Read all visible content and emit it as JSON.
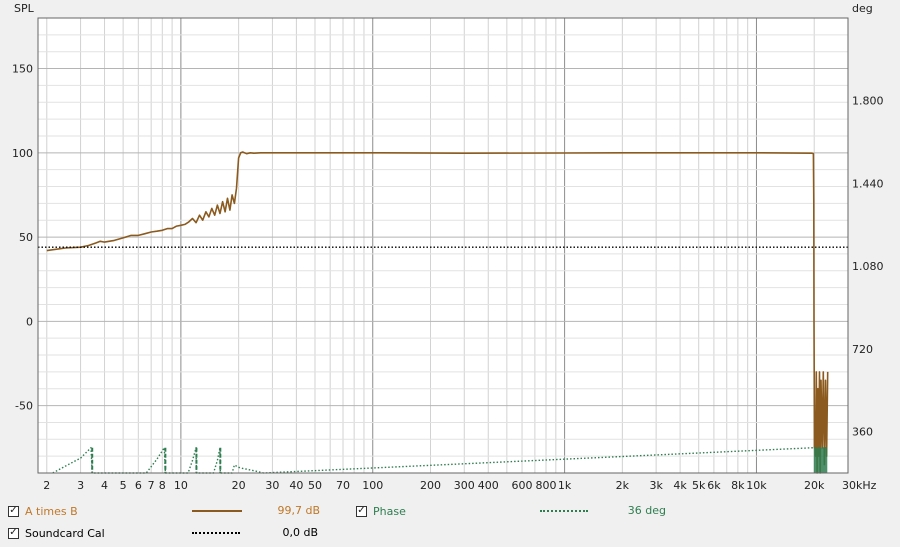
{
  "chart_data": {
    "type": "line",
    "xlabel": "",
    "xunit": "kHz",
    "xscale": "log",
    "xlim": [
      1.8,
      30000
    ],
    "x_ticks": [
      {
        "v": 2,
        "l": "2"
      },
      {
        "v": 3,
        "l": "3"
      },
      {
        "v": 4,
        "l": "4"
      },
      {
        "v": 5,
        "l": "5"
      },
      {
        "v": 6,
        "l": "6"
      },
      {
        "v": 7,
        "l": "7"
      },
      {
        "v": 8,
        "l": "8"
      },
      {
        "v": 10,
        "l": "10"
      },
      {
        "v": 20,
        "l": "20"
      },
      {
        "v": 30,
        "l": "30"
      },
      {
        "v": 40,
        "l": "40"
      },
      {
        "v": 50,
        "l": "50"
      },
      {
        "v": 70,
        "l": "70"
      },
      {
        "v": 100,
        "l": "100"
      },
      {
        "v": 200,
        "l": "200"
      },
      {
        "v": 300,
        "l": "300"
      },
      {
        "v": 400,
        "l": "400"
      },
      {
        "v": 600,
        "l": "600"
      },
      {
        "v": 800,
        "l": "800"
      },
      {
        "v": 1000,
        "l": "1k"
      },
      {
        "v": 2000,
        "l": "2k"
      },
      {
        "v": 3000,
        "l": "3k"
      },
      {
        "v": 4000,
        "l": "4k"
      },
      {
        "v": 5000,
        "l": "5k"
      },
      {
        "v": 6000,
        "l": "6k"
      },
      {
        "v": 8000,
        "l": "8k"
      },
      {
        "v": 10000,
        "l": "10k"
      },
      {
        "v": 20000,
        "l": "20k"
      },
      {
        "v": 30000,
        "l": "30kHz"
      }
    ],
    "ylabel_left": "SPL",
    "ylim_left": [
      -90,
      180
    ],
    "y_ticks_left": [
      -50,
      0,
      50,
      100,
      150
    ],
    "ylabel_right": "deg",
    "ylim_right": [
      180,
      2160
    ],
    "y_ticks_right": [
      {
        "v": 360,
        "l": "360"
      },
      {
        "v": 720,
        "l": "720"
      },
      {
        "v": 1080,
        "l": "1.080"
      },
      {
        "v": 1440,
        "l": "1.440"
      },
      {
        "v": 1800,
        "l": "1.800"
      }
    ],
    "grid": true,
    "series": [
      {
        "name": "A times B",
        "axis": "left",
        "color": "#8b5a1e",
        "style": "solid",
        "x": [
          2,
          2.5,
          3,
          3.3,
          3.6,
          3.8,
          4,
          4.5,
          5,
          5.5,
          6,
          6.5,
          7,
          7.5,
          8,
          8.5,
          9,
          9.5,
          10,
          10.5,
          11,
          11.5,
          12,
          12.5,
          13,
          13.5,
          14,
          14.5,
          15,
          15.5,
          16,
          16.5,
          17,
          17.5,
          18,
          18.5,
          19,
          19.5,
          20,
          20.5,
          21,
          22,
          23,
          24,
          26,
          30,
          40,
          100,
          300,
          1000,
          2000,
          5000,
          10000,
          19500,
          19800,
          19900,
          19950,
          20000,
          20050,
          20150,
          20300,
          20500,
          20700,
          20900,
          21100,
          21300,
          21500,
          21700,
          22000,
          22300,
          22600,
          22900,
          23200,
          23500
        ],
        "values": [
          42,
          43.5,
          44,
          45,
          46.5,
          47.5,
          47,
          48,
          49.5,
          51,
          51,
          52,
          53,
          53.5,
          54,
          55,
          55,
          56.5,
          57,
          57.5,
          59,
          61,
          58.5,
          63,
          60,
          65,
          62,
          67,
          63,
          69,
          64,
          71,
          65,
          73,
          66,
          75,
          70,
          79,
          97,
          100,
          100.5,
          99.5,
          100,
          99.8,
          100,
          100,
          100,
          100,
          99.8,
          99.9,
          100,
          100,
          100,
          99.8,
          99.5,
          70,
          0,
          -30,
          -75,
          -55,
          -80,
          -30,
          -90,
          -40,
          -80,
          -30,
          -90,
          -35,
          -75,
          -30,
          -85,
          -35,
          -80,
          -30
        ],
        "value_label": "99,7 dB"
      },
      {
        "name": "Phase",
        "axis": "right",
        "color": "#2e7d50",
        "style": "dotted",
        "x": [
          2.15,
          2.5,
          3,
          3.4,
          3.45,
          6.6,
          7.5,
          8.2,
          8.3,
          10.9,
          11.5,
          12,
          12.05,
          14.8,
          15.5,
          16,
          16.05,
          18.5,
          19,
          20,
          21,
          24,
          27,
          19900,
          20000,
          22000,
          23400
        ],
        "values": [
          180,
          210,
          245,
          290,
          180,
          180,
          240,
          290,
          180,
          180,
          235,
          290,
          180,
          180,
          235,
          290,
          180,
          180,
          215,
          205,
          200,
          190,
          180,
          290,
          290,
          290,
          290
        ],
        "value_label": "36 deg"
      },
      {
        "name": "Soundcard Cal",
        "axis": "left",
        "color": "#000000",
        "style": "dotted",
        "x": [
          1.8,
          30000
        ],
        "values": [
          44,
          44
        ],
        "value_label": "0,0 dB"
      }
    ]
  },
  "legend": [
    {
      "name": "A times B",
      "checked": "✓",
      "value": "99,7 dB",
      "color": "#c07828"
    },
    {
      "name": "Phase",
      "checked": "✓",
      "value": "36 deg",
      "color": "#2e7d50"
    },
    {
      "name": "Soundcard Cal",
      "checked": "✓",
      "value": "0,0 dB",
      "color": "#000000"
    }
  ]
}
